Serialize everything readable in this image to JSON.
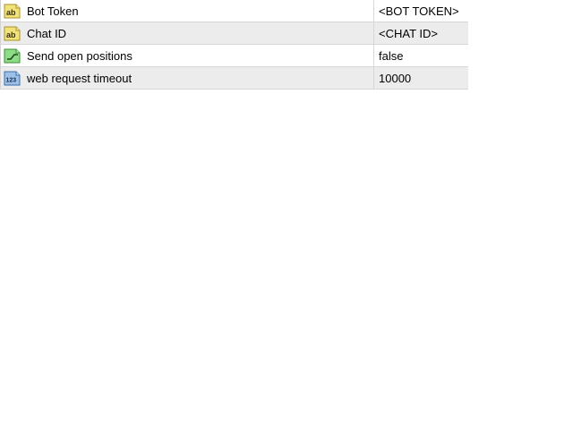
{
  "parameters": [
    {
      "icon": "string-ab-icon",
      "name": "Bot Token",
      "value": "<BOT TOKEN>"
    },
    {
      "icon": "string-ab-icon",
      "name": "Chat ID",
      "value": "<CHAT ID>"
    },
    {
      "icon": "boolean-toggle-icon",
      "name": "Send open positions",
      "value": "false"
    },
    {
      "icon": "integer-123-icon",
      "name": "web request timeout",
      "value": "10000"
    }
  ],
  "colors": {
    "string_icon": "#e8d56a",
    "bool_icon": "#7fd17a",
    "int_icon": "#7fa8d8",
    "alt_row": "#ececec"
  }
}
